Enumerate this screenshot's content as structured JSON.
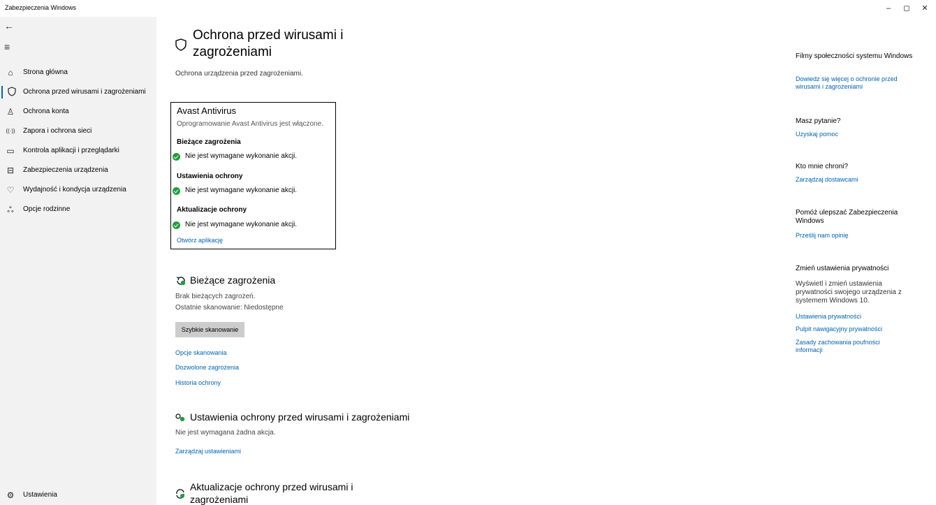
{
  "window": {
    "title": "Zabezpieczenia Windows",
    "controls": {
      "minimize": "–",
      "maximize": "◻",
      "close": "✕"
    }
  },
  "sidebar": {
    "back_icon": "←",
    "menu_icon": "≡",
    "items": [
      {
        "label": "Strona główna",
        "icon": "home-icon",
        "glyph": "⌂"
      },
      {
        "label": "Ochrona przed wirusami i zagrożeniami",
        "icon": "shield-icon",
        "glyph": "◇",
        "active": true
      },
      {
        "label": "Ochrona konta",
        "icon": "person-icon",
        "glyph": "♙"
      },
      {
        "label": "Zapora i ochrona sieci",
        "icon": "wifi-icon",
        "glyph": "((·))"
      },
      {
        "label": "Kontrola aplikacji i przeglądarki",
        "icon": "browser-icon",
        "glyph": "▭"
      },
      {
        "label": "Zabezpieczenia urządzenia",
        "icon": "laptop-icon",
        "glyph": "⊟"
      },
      {
        "label": "Wydajność i kondycja urządzenia",
        "icon": "heart-icon",
        "glyph": "♡"
      },
      {
        "label": "Opcje rodzinne",
        "icon": "family-icon",
        "glyph": "ஃ"
      }
    ],
    "settings": {
      "label": "Ustawienia",
      "icon": "gear-icon",
      "glyph": "⚙"
    }
  },
  "main": {
    "title": "Ochrona przed wirusami i zagrożeniami",
    "subtitle": "Ochrona urządzenia przed zagrożeniami.",
    "provider": {
      "name": "Avast Antivirus",
      "status": "Oprogramowanie Avast Antivirus jest włączone.",
      "groups": [
        {
          "heading": "Bieżące zagrożenia",
          "text": "Nie jest wymagane wykonanie akcji."
        },
        {
          "heading": "Ustawienia ochrony",
          "text": "Nie jest wymagane wykonanie akcji."
        },
        {
          "heading": "Aktualizacje ochrony",
          "text": "Nie jest wymagane wykonanie akcji."
        }
      ],
      "open_link": "Otwórz aplikację"
    },
    "threats": {
      "title": "Bieżące zagrożenia",
      "line1": "Brak bieżących zagrożeń.",
      "line2": "Ostatnie skanowanie: Niedostępne",
      "scan_button": "Szybkie skanowanie",
      "links": [
        "Opcje skanowania",
        "Dozwolone zagrożenia",
        "Historia ochrony"
      ]
    },
    "settings_section": {
      "title": "Ustawienia ochrony przed wirusami i zagrożeniami",
      "text": "Nie jest wymagana żadna akcja.",
      "link": "Zarządzaj ustawieniami"
    },
    "updates_section": {
      "title": "Aktualizacje ochrony przed wirusami i zagrożeniami"
    }
  },
  "right": {
    "community": {
      "heading": "Filmy społeczności systemu Windows",
      "link": "Dowiedz się więcej o ochronie przed wirusami i zagrożeniami"
    },
    "question": {
      "heading": "Masz pytanie?",
      "link": "Uzyskaj pomoc"
    },
    "who": {
      "heading": "Kto mnie chroni?",
      "link": "Zarządzaj dostawcami"
    },
    "improve": {
      "heading": "Pomóż ulepszać Zabezpieczenia Windows",
      "link": "Prześlij nam opinię"
    },
    "privacy": {
      "heading": "Zmień ustawienia prywatności",
      "text": "Wyświetl i zmień ustawienia prywatności swojego urządzenia z systemem Windows 10.",
      "links": [
        "Ustawienia prywatności",
        "Pulpit nawigacyjny prywatności",
        "Zasady zachowania poufności informacji"
      ]
    }
  },
  "colors": {
    "accent": "#0063b1",
    "sidebar_bg": "#f2f2f2",
    "ok_green": "#1e9f3a"
  }
}
